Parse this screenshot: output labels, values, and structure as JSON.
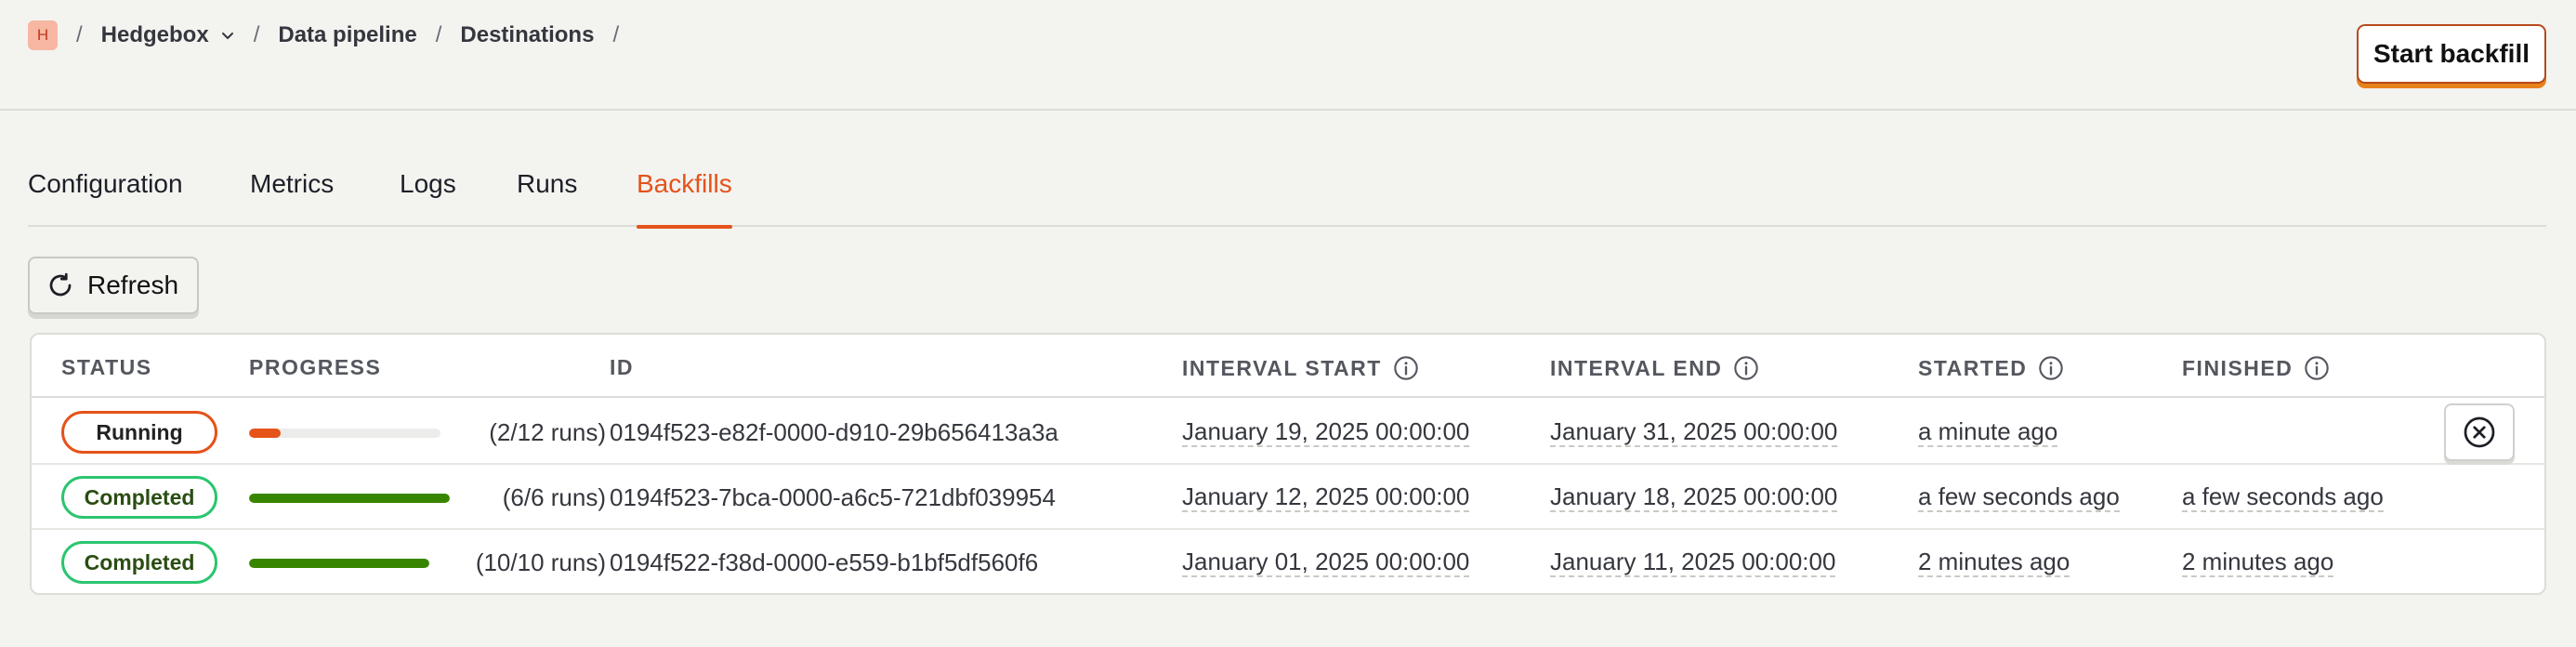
{
  "breadcrumb": {
    "org_initial": "H",
    "project": "Hedgebox",
    "items": [
      "Data pipeline",
      "Destinations"
    ],
    "separator": "/"
  },
  "header": {
    "start_backfill_label": "Start backfill"
  },
  "tabs": [
    {
      "label": "Configuration",
      "active": false
    },
    {
      "label": "Metrics",
      "active": false
    },
    {
      "label": "Logs",
      "active": false
    },
    {
      "label": "Runs",
      "active": false
    },
    {
      "label": "Backfills",
      "active": true
    }
  ],
  "toolbar": {
    "refresh_label": "Refresh"
  },
  "table": {
    "columns": [
      "Status",
      "Progress",
      "ID",
      "Interval start",
      "Interval end",
      "Started",
      "Finished"
    ],
    "rows": [
      {
        "status": "Running",
        "progress": 0.1667,
        "runs_text": "(2/12 runs)",
        "id": "0194f523-e82f-0000-d910-29b656413a3a",
        "interval_start": "January 19, 2025 00:00:00",
        "interval_end": "January 31, 2025 00:00:00",
        "started": "a minute ago",
        "finished": ""
      },
      {
        "status": "Completed",
        "progress": 1.0,
        "runs_text": "(6/6 runs)",
        "id": "0194f523-7bca-0000-a6c5-721dbf039954",
        "interval_start": "January 12, 2025 00:00:00",
        "interval_end": "January 18, 2025 00:00:00",
        "started": "a few seconds ago",
        "finished": "a few seconds ago"
      },
      {
        "status": "Completed",
        "progress": 1.0,
        "runs_text": "(10/10 runs)",
        "id": "0194f522-f38d-0000-e559-b1bf5df560f6",
        "interval_start": "January 01, 2025 00:00:00",
        "interval_end": "January 11, 2025 00:00:00",
        "started": "2 minutes ago",
        "finished": "2 minutes ago"
      }
    ]
  },
  "colors": {
    "accent": "#e5521a",
    "running": "#e5521a",
    "completed_border": "#2bc56f",
    "progress_running": "#e5521a",
    "progress_completed": "#388600"
  },
  "icons": {
    "refresh": "refresh-icon",
    "info": "info-icon",
    "cancel": "cancel-circle-icon",
    "chevron": "chevron-down-icon"
  }
}
